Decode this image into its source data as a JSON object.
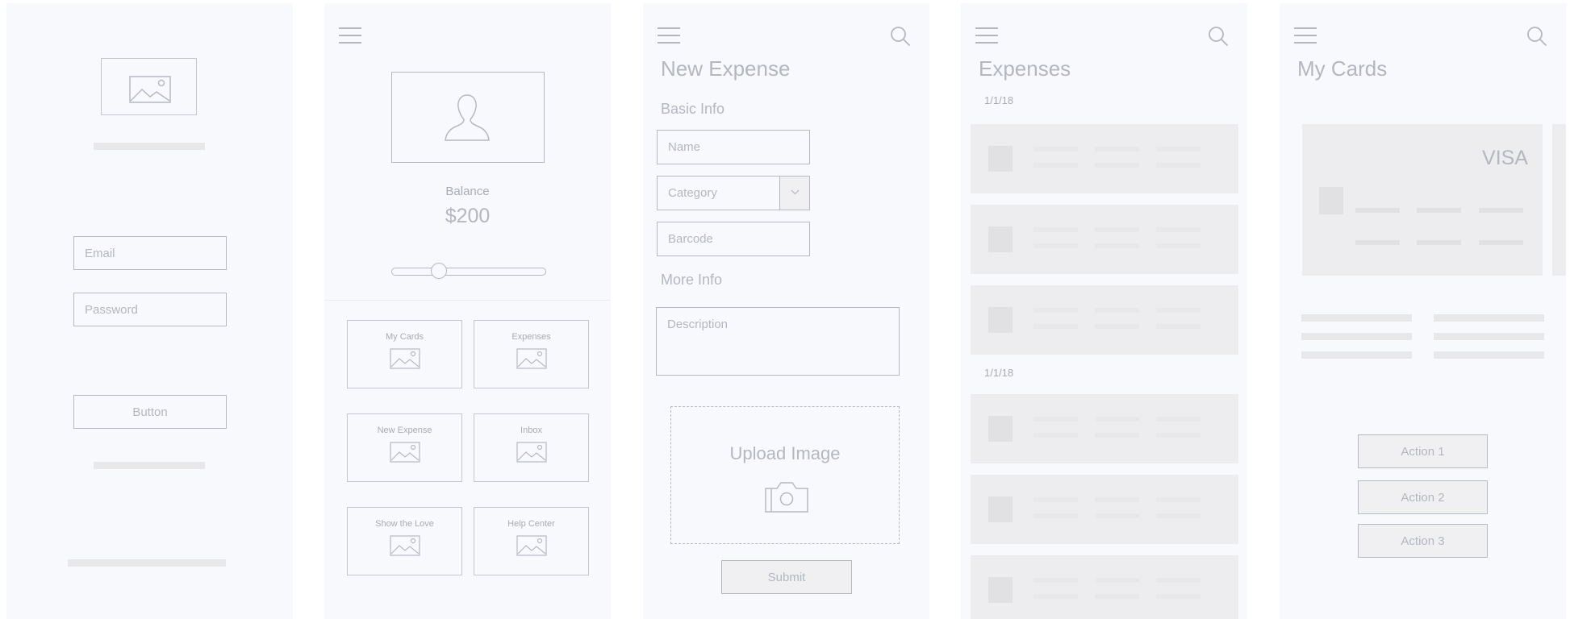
{
  "login": {
    "email_placeholder": "Email",
    "password_placeholder": "Password",
    "button_label": "Button"
  },
  "home": {
    "balance_label": "Balance",
    "balance_value": "$200",
    "balance_slider_fraction": 0.28,
    "tiles": [
      {
        "label": "My Cards",
        "icon": "image-icon"
      },
      {
        "label": "Expenses",
        "icon": "image-icon"
      },
      {
        "label": "New Expense",
        "icon": "image-icon"
      },
      {
        "label": "Inbox",
        "icon": "image-icon"
      },
      {
        "label": "Show the Love",
        "icon": "image-icon"
      },
      {
        "label": "Help Center",
        "icon": "image-icon"
      }
    ]
  },
  "new_expense": {
    "title": "New Expense",
    "basic_info": "Basic Info",
    "name_placeholder": "Name",
    "category_placeholder": "Category",
    "barcode_placeholder": "Barcode",
    "more_info": "More Info",
    "description_placeholder": "Description",
    "upload_label": "Upload Image",
    "submit_label": "Submit"
  },
  "expenses": {
    "title": "Expenses",
    "groups": [
      {
        "date": "1/1/18"
      },
      {
        "date": "1/1/18"
      }
    ]
  },
  "my_cards": {
    "title": "My Cards",
    "card_brand": "VISA",
    "actions": [
      "Action 1",
      "Action 2",
      "Action 3"
    ]
  },
  "colors": {
    "screen_bg": "#f8f9fd",
    "stroke": "#b6b9c1",
    "text": "#b4b7bf",
    "placeholder_bar": "#e8e8ea",
    "row_bg": "#ededef"
  }
}
